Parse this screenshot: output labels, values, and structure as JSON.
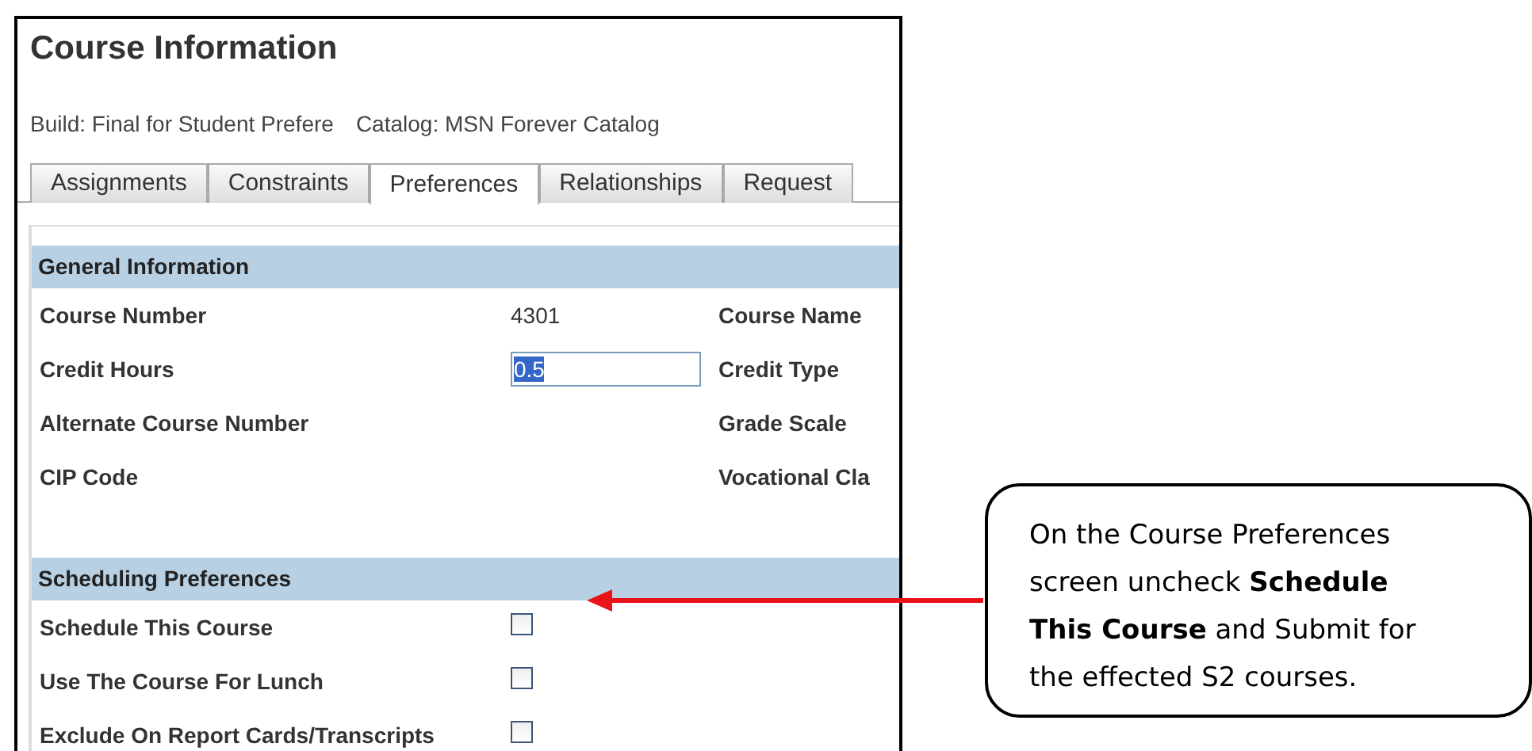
{
  "title": "Course Information",
  "build": "Build: Final for Student Prefere",
  "catalog": "Catalog: MSN Forever Catalog",
  "tabs": [
    {
      "label": "Assignments",
      "selected": false
    },
    {
      "label": "Constraints",
      "selected": false
    },
    {
      "label": "Preferences",
      "selected": true
    },
    {
      "label": "Relationships",
      "selected": false
    },
    {
      "label": "Request",
      "selected": false
    }
  ],
  "general_information": {
    "header": "General Information",
    "rows": [
      {
        "label": "Course Number",
        "kind": "text",
        "value": "4301",
        "label_2": "Course Name"
      },
      {
        "label": "Credit Hours",
        "kind": "input",
        "value": "0.5",
        "label_2": "Credit Type"
      },
      {
        "label": "Alternate Course Number",
        "kind": "empty",
        "label_2": "Grade Scale"
      },
      {
        "label": "CIP Code",
        "kind": "empty",
        "label_2": "Vocational Cla"
      }
    ]
  },
  "scheduling_preferences": {
    "header": "Scheduling Preferences",
    "rows": [
      {
        "label": "Schedule This Course",
        "checked": false
      },
      {
        "label": "Use The Course For Lunch",
        "checked": false
      },
      {
        "label": "Exclude On Report Cards/Transcripts",
        "checked": false
      }
    ]
  },
  "callout": {
    "text": "On the Course Preferences screen uncheck **Schedule This Course** and Submit for the effected S2 courses."
  }
}
